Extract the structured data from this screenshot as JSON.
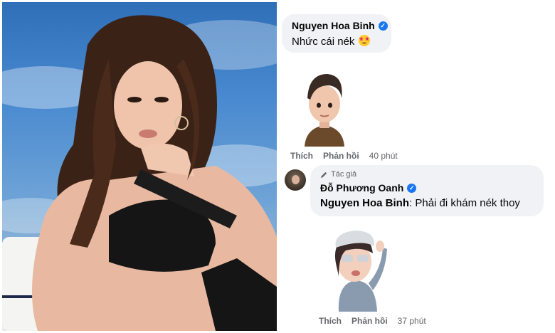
{
  "comment1": {
    "author": "Nguyen Hoa Binh",
    "text": "Nhức cái nék",
    "emoji": "star-struck-emoji",
    "sticker": "avatar-man-sticker",
    "actions": {
      "like": "Thích",
      "reply": "Phản hồi",
      "time": "40 phút"
    }
  },
  "comment2": {
    "badge": "Tác giả",
    "author": "Đỗ Phương Oanh",
    "mention": "Nguyen Hoa Binh",
    "text": ": Phải đi khám nék thoy",
    "sticker": "avatar-woman-sticker",
    "actions": {
      "like": "Thích",
      "reply": "Phản hồi",
      "time": "37 phút"
    }
  },
  "colors": {
    "bubble": "#f0f2f5",
    "verified": "#1877f2",
    "meta": "#65676b",
    "sky": "#4a8ad0"
  }
}
